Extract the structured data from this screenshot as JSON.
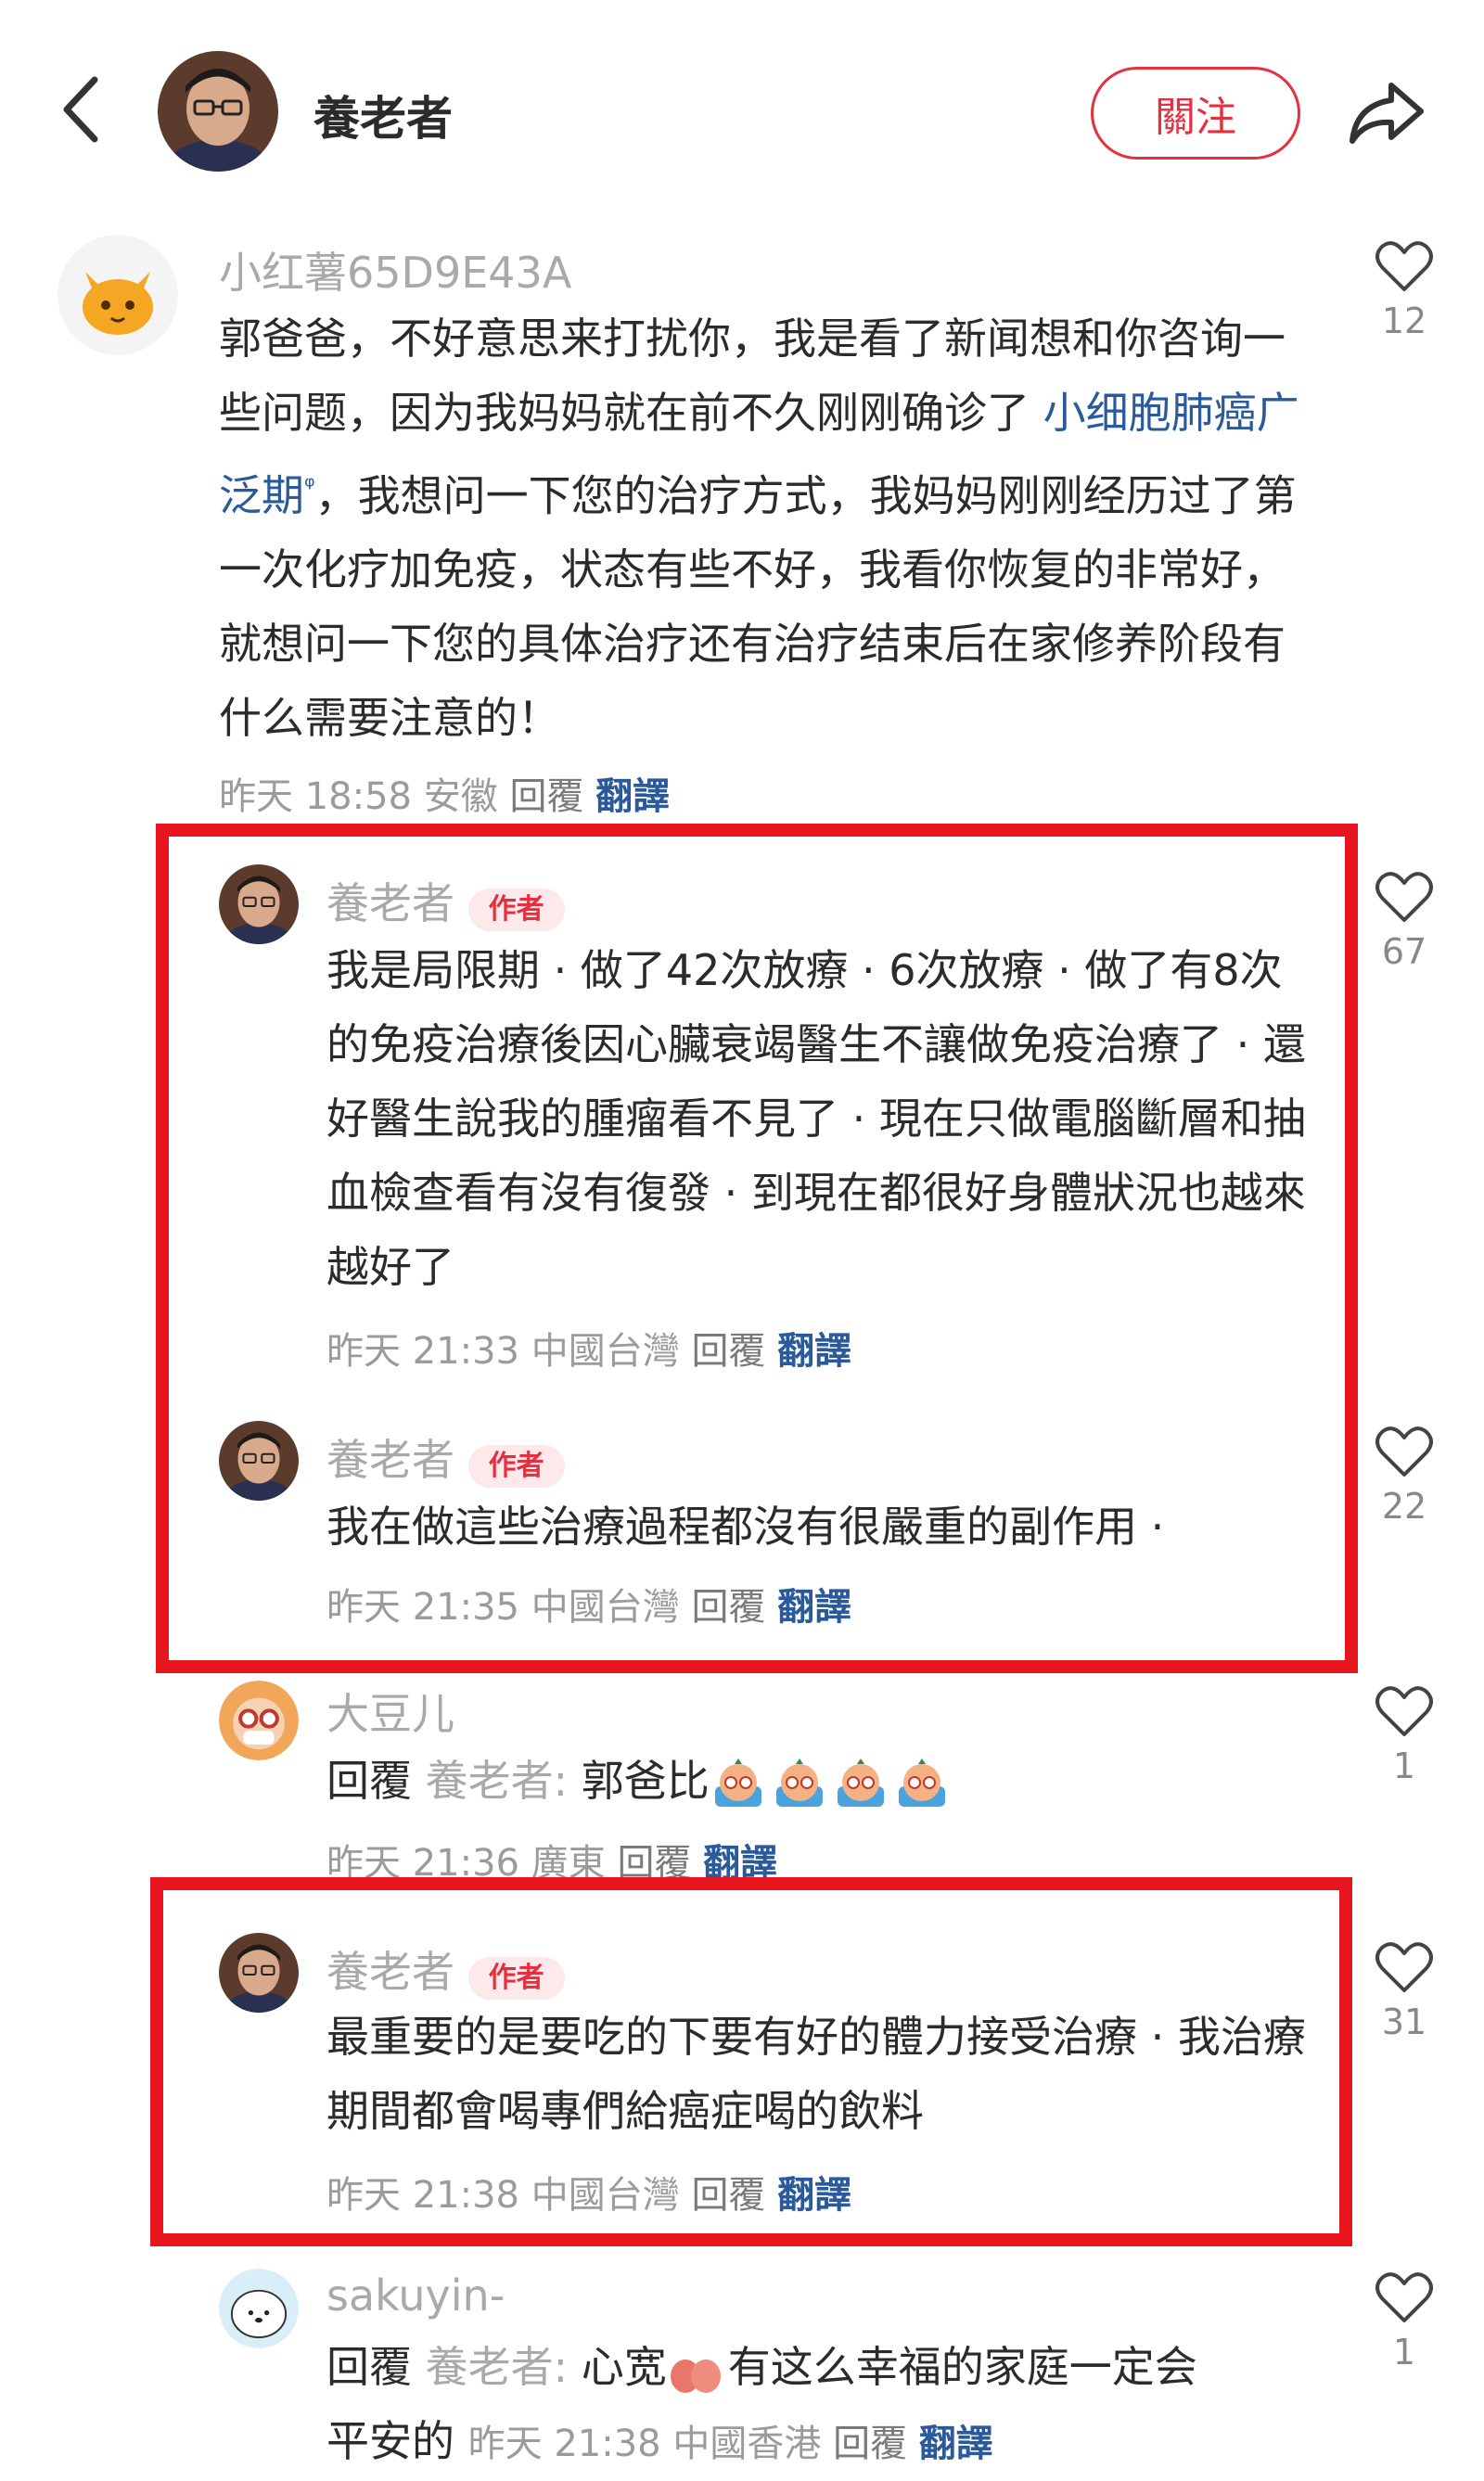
{
  "header": {
    "title": "養老者",
    "follow_label": "關注"
  },
  "comments": [
    {
      "username": "小红薯65D9E43A",
      "text_before_link": "郭爸爸，不好意思来打扰你，我是看了新闻想和你咨询一些问题，因为我妈妈就在前不久刚刚确诊了",
      "link_text": "小细胞肺癌广泛期",
      "text_after_link": "，我想问一下您的治疗方式，我妈妈刚刚经历过了第一次化疗加免疫，状态有些不好，我看你恢复的非常好，就想问一下您的具体治疗还有治疗结束后在家修养阶段有什么需要注意的！",
      "time": "昨天 18:58",
      "location": "安徽",
      "reply_label": "回覆",
      "translate_label": "翻譯",
      "likes": "12"
    },
    {
      "username": "養老者",
      "badge": "作者",
      "text": "我是局限期 · 做了42次放療 · 6次放療 · 做了有8次的免疫治療後因心臟衰竭醫生不讓做免疫治療了 · 還好醫生說我的腫瘤看不見了 · 現在只做電腦斷層和抽血檢查看有沒有復發 · 到現在都很好身體狀況也越來越好了",
      "time": "昨天 21:33",
      "location": "中國台灣",
      "reply_label": "回覆",
      "translate_label": "翻譯",
      "likes": "67"
    },
    {
      "username": "養老者",
      "badge": "作者",
      "text": "我在做這些治療過程都沒有很嚴重的副作用 ·",
      "time": "昨天 21:35",
      "location": "中國台灣",
      "reply_label": "回覆",
      "translate_label": "翻譯",
      "likes": "22"
    },
    {
      "username": "大豆儿",
      "reply_prefix": "回覆",
      "mention": "養老者:",
      "text": " 郭爸比",
      "emoji_count": 4,
      "time": "昨天 21:36",
      "location": "廣東",
      "reply_label": "回覆",
      "translate_label": "翻譯",
      "likes": "1"
    },
    {
      "username": "養老者",
      "badge": "作者",
      "text": "最重要的是要吃的下要有好的體力接受治療 · 我治療期間都會喝專們給癌症喝的飲料",
      "time": "昨天 21:38",
      "location": "中國台灣",
      "reply_label": "回覆",
      "translate_label": "翻譯",
      "likes": "31"
    },
    {
      "username": "sakuyin-",
      "reply_prefix": "回覆",
      "mention": "養老者:",
      "text_part1": " 心宽",
      "text_part2": "有这么幸福的家庭一定会",
      "text_line2": "平安的",
      "time": "昨天 21:38",
      "location": "中國香港",
      "reply_label": "回覆",
      "translate_label": "翻譯",
      "likes": "1"
    }
  ],
  "colors": {
    "accent_red": "#e6303f",
    "highlight_red": "#e8141e",
    "link_blue": "#2a5a9c",
    "muted_gray": "#a9a9a9"
  },
  "icons": [
    "back-arrow-icon",
    "share-icon",
    "heart-icon",
    "search-link-icon",
    "emoji-icon",
    "peach-emoji-icon"
  ]
}
